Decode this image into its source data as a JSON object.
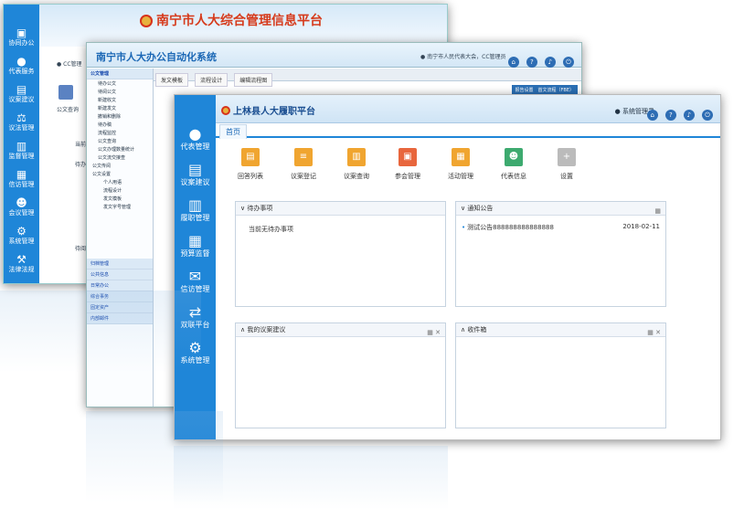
{
  "win1": {
    "title": "南宁市人大综合管理信息平台",
    "user": "CC管理",
    "nav": [
      {
        "icon": "briefcase-icon",
        "label": "协同办公"
      },
      {
        "icon": "user-icon",
        "label": "代表服务"
      },
      {
        "icon": "document-icon",
        "label": "议案建议"
      },
      {
        "icon": "scale-icon",
        "label": "议法管理"
      },
      {
        "icon": "clipboard-icon",
        "label": "监督管理"
      },
      {
        "icon": "chart-icon",
        "label": "信访管理"
      },
      {
        "icon": "group-icon",
        "label": "会议管理"
      },
      {
        "icon": "gear-icon",
        "label": "系统管理"
      },
      {
        "icon": "gavel-icon",
        "label": "法律法规"
      }
    ],
    "content_labels": [
      "公文查询",
      "当前",
      "待办",
      "待阅"
    ]
  },
  "win2": {
    "title": "南宁市人大办公自动化系统",
    "user": "南宁市人民代表大会，CC管理员",
    "tabs": [
      "发文模板",
      "流程设计",
      "编辑流程图"
    ],
    "toolbar_links": [
      "报告设置",
      "首文流程（FBE）"
    ],
    "tree_group1": "公文管理",
    "tree_items": [
      "待办公文",
      "待阅公文",
      "新建收文",
      "新建发文",
      "撤销和删除",
      "待办稿",
      "流程监控",
      "公文查询",
      "公文办理数量统计",
      "公文流交接查"
    ],
    "tree_groups2": [
      "公文传阅",
      "公文设置"
    ],
    "tree_sub": [
      "个人用语",
      "流程设计",
      "发文模板",
      "发文字号管理"
    ],
    "tree_bottom": [
      "归档管理",
      "公共信息",
      "日常办公",
      "综合事务",
      "固定资产",
      "内部邮件"
    ]
  },
  "win3": {
    "title": "上林县人大履职平台",
    "user": "系统管理员",
    "tab": "首页",
    "nav": [
      {
        "icon": "user-icon",
        "label": "代表管理"
      },
      {
        "icon": "document-icon",
        "label": "议案建议"
      },
      {
        "icon": "book-icon",
        "label": "履职管理"
      },
      {
        "icon": "bar-chart-icon",
        "label": "预算监督"
      },
      {
        "icon": "mail-icon",
        "label": "信访管理"
      },
      {
        "icon": "swap-icon",
        "label": "双联平台"
      },
      {
        "icon": "gear-icon",
        "label": "系统管理"
      }
    ],
    "quick": [
      {
        "label": "回答列表",
        "color": "#f0a530"
      },
      {
        "label": "议案登记",
        "color": "#f0a530"
      },
      {
        "label": "议案查询",
        "color": "#f0a530"
      },
      {
        "label": "参会管理",
        "color": "#e8663d"
      },
      {
        "label": "活动管理",
        "color": "#f0a530"
      },
      {
        "label": "代表信息",
        "color": "#3daa6f"
      },
      {
        "label": "设置",
        "color": "#bbbbbb"
      }
    ],
    "panels": {
      "todo_title": "待办事项",
      "todo_empty": "当前无待办事项",
      "notice_title": "通知公告",
      "notice_item": "测试公告888888888888888",
      "notice_date": "2018-02-11",
      "proposal_title": "我的议案建议",
      "inbox_title": "收件箱"
    }
  }
}
